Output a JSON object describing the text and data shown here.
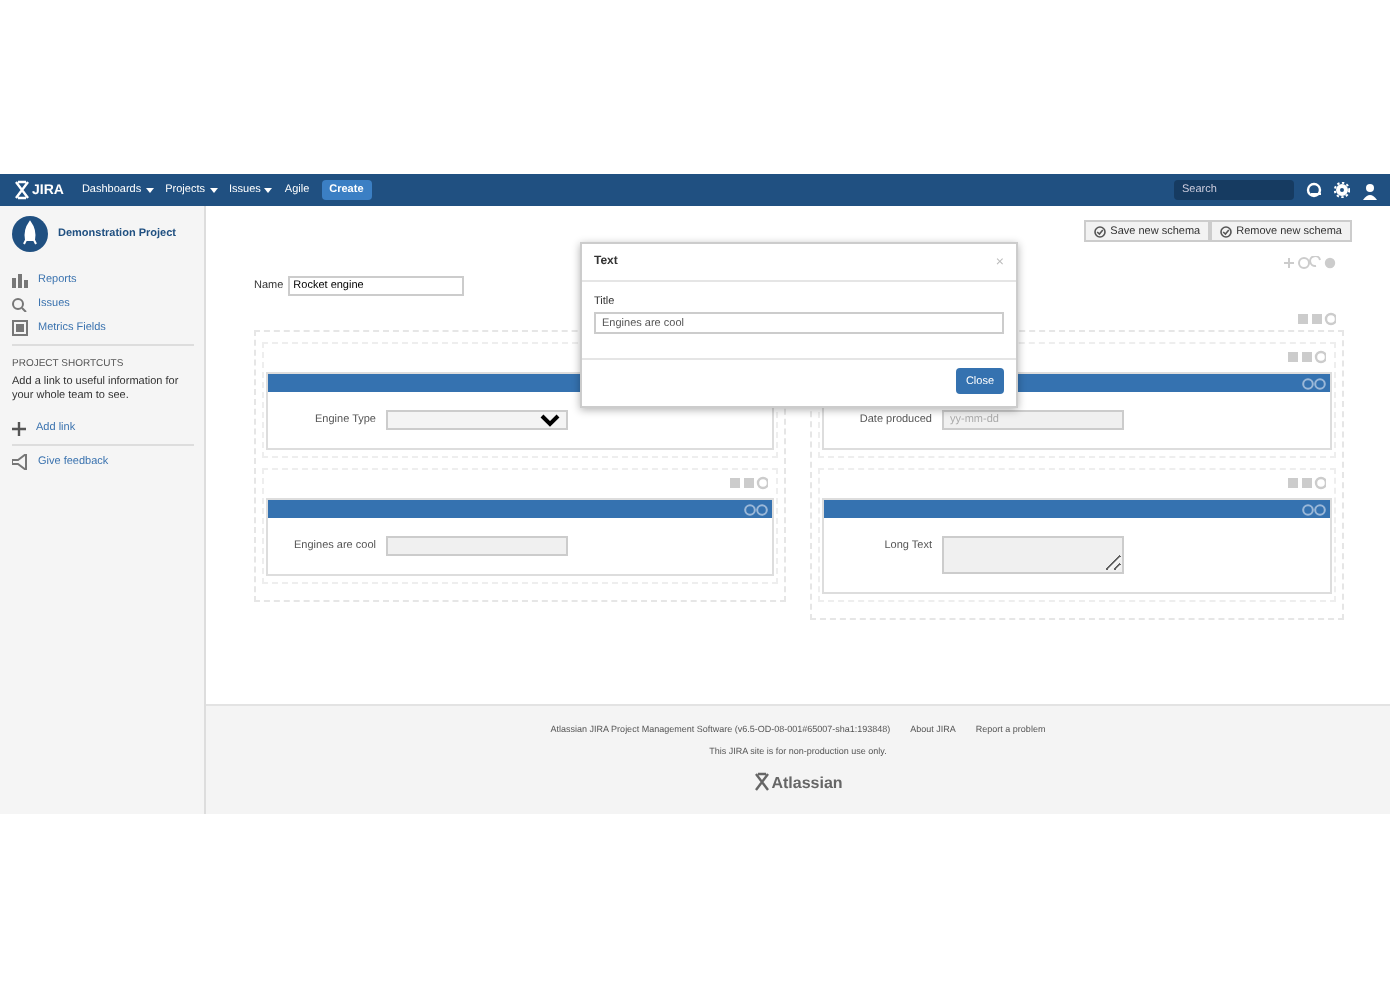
{
  "nav": {
    "logo": "JIRA",
    "menus": [
      {
        "label": "Dashboards",
        "dropdown": true
      },
      {
        "label": "Projects",
        "dropdown": true
      },
      {
        "label": "Issues",
        "dropdown": true
      },
      {
        "label": "Agile",
        "dropdown": false
      }
    ],
    "create": "Create",
    "search": {
      "placeholder": "Search"
    }
  },
  "sidebar": {
    "project": "Demonstration Project",
    "items": [
      {
        "label": "Reports"
      },
      {
        "label": "Issues"
      },
      {
        "label": "Metrics Fields"
      }
    ],
    "shortcuts_heading": "PROJECT SHORTCUTS",
    "shortcuts_text": "Add a link to useful information for your whole team to see.",
    "add_link": "Add link",
    "feedback": "Give feedback"
  },
  "toolbar": {
    "buttons": [
      "Save new schema",
      "Remove new schema"
    ]
  },
  "name_field": {
    "label": "Name",
    "value": "Rocket engine"
  },
  "columns": [
    {
      "panels": [
        {
          "label": "Engine Type",
          "kind": "select"
        },
        {
          "label": "Engines are cool",
          "kind": "text"
        }
      ]
    },
    {
      "panels": [
        {
          "label": "Date produced",
          "kind": "text",
          "placeholder": "yy-mm-dd"
        },
        {
          "label": "Long Text",
          "kind": "textarea"
        }
      ]
    }
  ],
  "dialog": {
    "title": "Text",
    "close": "×",
    "field_label": "Title",
    "value": "Engines are cool",
    "button": "Close"
  },
  "footer": {
    "links": [
      "Atlassian JIRA Project Management Software (v6.5-OD-08-001#65007-sha1:193848)",
      "About JIRA",
      "Report a problem"
    ],
    "note": "This JIRA site is for non-production use only.",
    "logo": "Atlassian"
  }
}
